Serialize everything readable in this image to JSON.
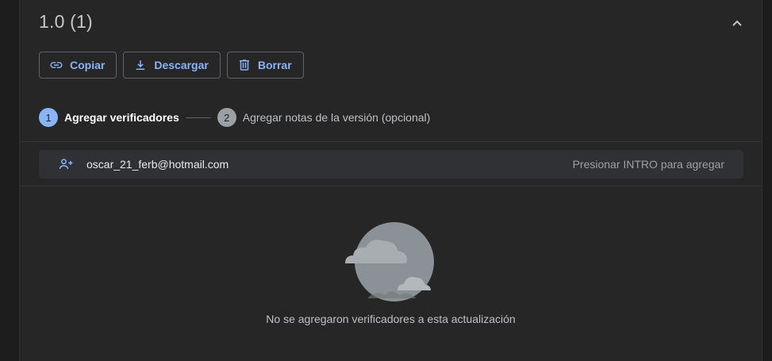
{
  "version": {
    "title": "1.0 (1)"
  },
  "actions": {
    "copy_label": "Copiar",
    "download_label": "Descargar",
    "delete_label": "Borrar"
  },
  "stepper": {
    "steps": [
      {
        "number": "1",
        "label": "Agregar verificadores",
        "state": "active"
      },
      {
        "number": "2",
        "label": "Agregar notas de la versión (opcional)",
        "state": "inactive"
      }
    ]
  },
  "reviewer_input": {
    "value": "oscar_21_ferb@hotmail.com",
    "hint": "Presionar INTRO para agregar"
  },
  "empty_state": {
    "message": "No se agregaron verificadores a esta actualización",
    "icon": "cloud-illustration-icon"
  },
  "colors": {
    "accent": "#8ab4f8",
    "background": "#262626",
    "input_background": "#303134"
  }
}
